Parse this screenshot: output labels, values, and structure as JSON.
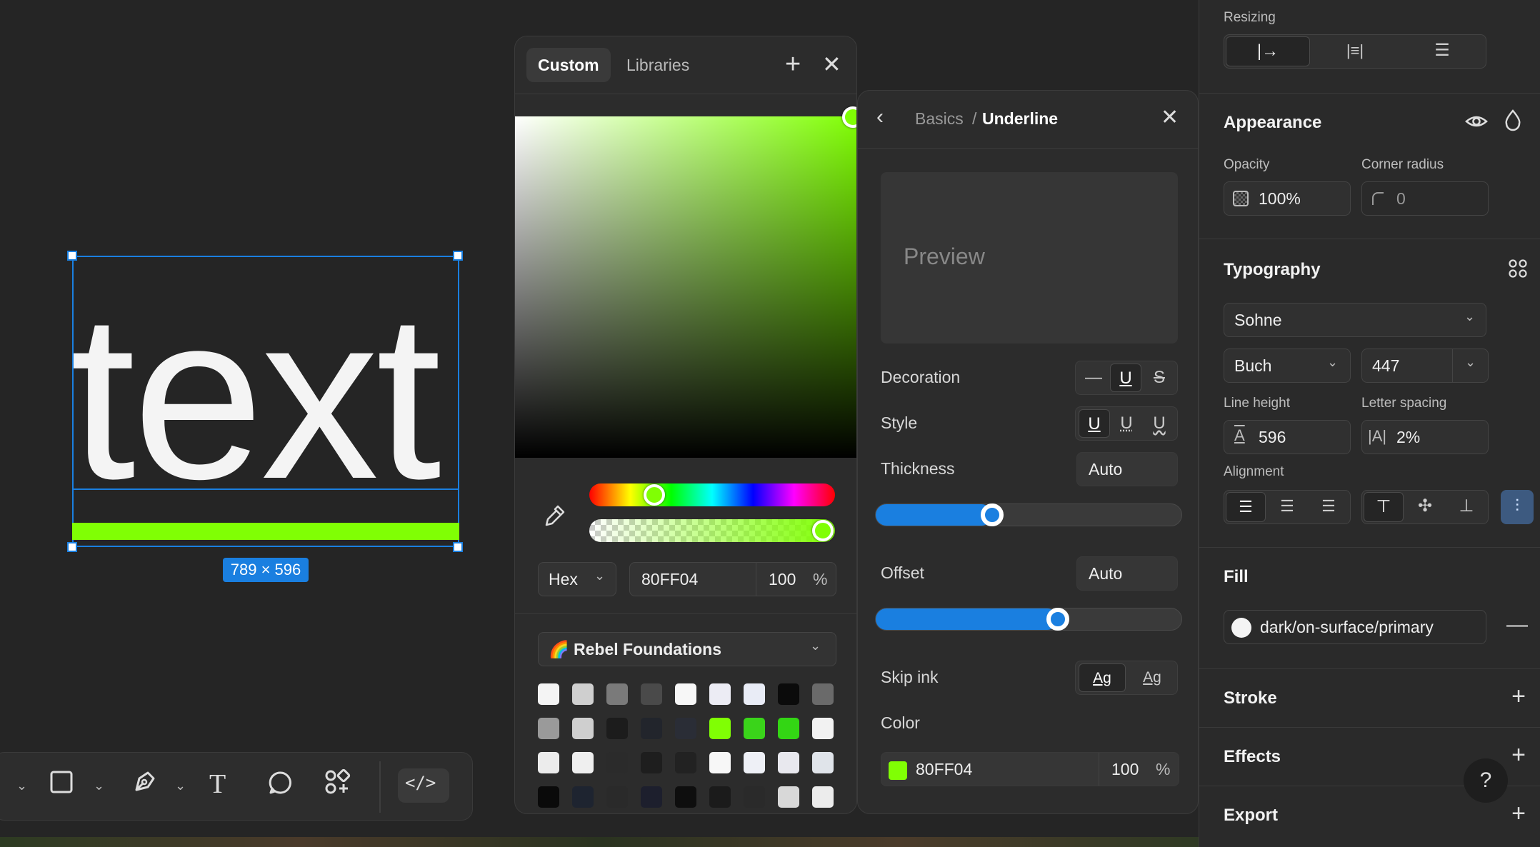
{
  "canvas": {
    "text_content": "text",
    "dimensions_badge": "789 × 596",
    "underline_color": "#80ff04",
    "selection_color": "#1a7fe0"
  },
  "color_picker": {
    "tabs": [
      "Custom",
      "Libraries"
    ],
    "active_tab": "Custom",
    "format": "Hex",
    "hex_value": "80FF04",
    "opacity_value": "100",
    "opacity_unit": "%",
    "library": "🌈 Rebel Foundations",
    "swatches": [
      [
        "#f4f4f4",
        "#cfcfcf",
        "#7a7a7a",
        "#4a4a4a",
        "#f7f7f7",
        "#ececf4",
        "#e9ecf6",
        "#0b0b0b",
        "#6a6a6a"
      ],
      [
        "#9a9a9a",
        "#cfcfcf",
        "#1c1c1c",
        "#22252c",
        "#2a2d36",
        "#80ff04",
        "#3ad41a",
        "#33d614",
        "#f2f2f2"
      ],
      [
        "#ececec",
        "#efefef",
        "#2b2b2b",
        "#1e1e1e",
        "#222222",
        "#f7f7f7",
        "#eef0f6",
        "#e8e8ee",
        "#e0e4ea"
      ],
      [
        "#0a0a0a",
        "#1e2430",
        "#2a2a2a",
        "#1d1f2d",
        "#0e0e0e",
        "#1b1b1b",
        "#2a2a2a",
        "#d8d8d8",
        "#ececec"
      ]
    ]
  },
  "underline_panel": {
    "breadcrumb_parent": "Basics",
    "breadcrumb_sep": "/",
    "breadcrumb_current": "Underline",
    "preview_label": "Preview",
    "decoration_label": "Decoration",
    "style_label": "Style",
    "thickness_label": "Thickness",
    "thickness_value": "Auto",
    "thickness_slider": 0.37,
    "offset_label": "Offset",
    "offset_value": "Auto",
    "offset_slider": 0.6,
    "skip_ink_label": "Skip ink",
    "skip_ink_options": [
      "Ag",
      "Ag"
    ],
    "color_label": "Color",
    "color_hex": "80FF04",
    "color_opacity": "100",
    "color_opacity_unit": "%"
  },
  "sidebar": {
    "resizing_label": "Resizing",
    "appearance_title": "Appearance",
    "opacity_label": "Opacity",
    "opacity_value": "100%",
    "corner_radius_label": "Corner radius",
    "corner_radius_value": "0",
    "typography_title": "Typography",
    "font_family": "Sohne",
    "font_style": "Buch",
    "font_size": "447",
    "line_height_label": "Line height",
    "line_height_value": "596",
    "letter_spacing_label": "Letter spacing",
    "letter_spacing_value": "2%",
    "alignment_label": "Alignment",
    "fill_title": "Fill",
    "fill_value": "dark/on-surface/primary",
    "stroke_title": "Stroke",
    "effects_title": "Effects",
    "export_title": "Export",
    "help": "?"
  }
}
